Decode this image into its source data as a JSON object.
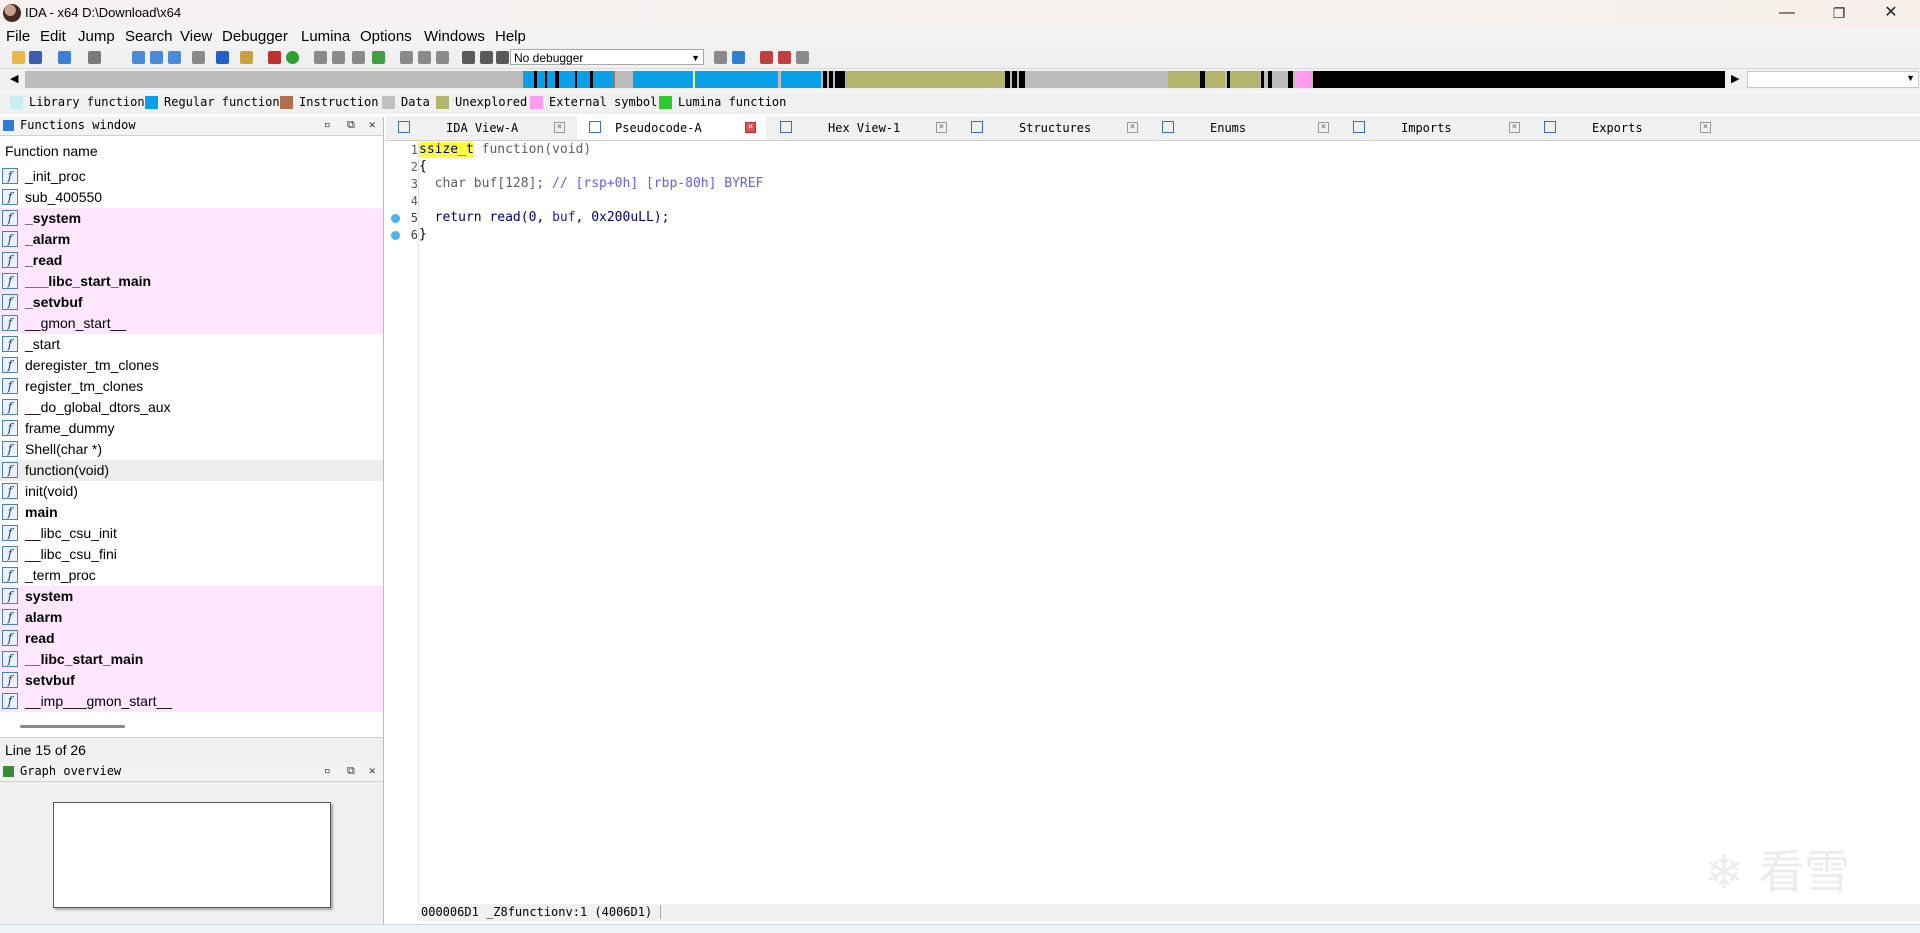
{
  "window": {
    "title": "IDA - x64 D:\\Download\\x64",
    "minimize": "—",
    "maximize": "❐",
    "close": "✕"
  },
  "menu": [
    "File",
    "Edit",
    "Jump",
    "Search",
    "View",
    "Debugger",
    "Lumina",
    "Options",
    "Windows",
    "Help"
  ],
  "toolbar": {
    "debugger_value": "No debugger"
  },
  "legend": [
    {
      "label": "Library function",
      "color": "#c8f0f0"
    },
    {
      "label": "Regular function",
      "color": "#0aa0e8"
    },
    {
      "label": "Instruction",
      "color": "#b07050"
    },
    {
      "label": "Data",
      "color": "#c0c0c0"
    },
    {
      "label": "Unexplored",
      "color": "#b4b46c"
    },
    {
      "label": "External symbol",
      "color": "#ff9cf0"
    },
    {
      "label": "Lumina function",
      "color": "#32c832"
    }
  ],
  "functions_window": {
    "title": "Functions window",
    "column_header": "Function name",
    "status": "Line 15 of 26",
    "items": [
      {
        "name": "_init_proc",
        "style": "normal"
      },
      {
        "name": "sub_400550",
        "style": "normal"
      },
      {
        "name": "_system",
        "style": "ext"
      },
      {
        "name": "_alarm",
        "style": "ext"
      },
      {
        "name": "_read",
        "style": "ext"
      },
      {
        "name": "___libc_start_main",
        "style": "ext"
      },
      {
        "name": "_setvbuf",
        "style": "ext"
      },
      {
        "name": "__gmon_start__",
        "style": "ext-plain"
      },
      {
        "name": "_start",
        "style": "normal"
      },
      {
        "name": "deregister_tm_clones",
        "style": "normal"
      },
      {
        "name": "register_tm_clones",
        "style": "normal"
      },
      {
        "name": "__do_global_dtors_aux",
        "style": "normal"
      },
      {
        "name": "frame_dummy",
        "style": "normal"
      },
      {
        "name": "Shell(char *)",
        "style": "normal"
      },
      {
        "name": "function(void)",
        "style": "selected"
      },
      {
        "name": "init(void)",
        "style": "normal"
      },
      {
        "name": "main",
        "style": "bold"
      },
      {
        "name": "__libc_csu_init",
        "style": "normal"
      },
      {
        "name": "__libc_csu_fini",
        "style": "normal"
      },
      {
        "name": "_term_proc",
        "style": "normal"
      },
      {
        "name": "system",
        "style": "ext"
      },
      {
        "name": "alarm",
        "style": "ext"
      },
      {
        "name": "read",
        "style": "ext"
      },
      {
        "name": "__libc_start_main",
        "style": "ext"
      },
      {
        "name": "setvbuf",
        "style": "ext"
      },
      {
        "name": "__imp___gmon_start__",
        "style": "ext-plain"
      }
    ]
  },
  "graph_overview": {
    "title": "Graph overview"
  },
  "tabs": [
    {
      "label": "IDA View-A",
      "active": false
    },
    {
      "label": "Pseudocode-A",
      "active": true
    },
    {
      "label": "Hex View-1",
      "active": false
    },
    {
      "label": "Structures",
      "active": false
    },
    {
      "label": "Enums",
      "active": false
    },
    {
      "label": "Imports",
      "active": false
    },
    {
      "label": "Exports",
      "active": false
    }
  ],
  "pseudocode": {
    "line_numbers": [
      "1",
      "2",
      "3",
      "4",
      "5",
      "6"
    ],
    "l1_type": "ssize_t",
    "l1_rest": " function(void)",
    "l2": "{",
    "l3_decl": "  char buf[128];",
    "l3_comment": " // [rsp+0h] [rbp-80h] BYREF",
    "l5_ret": "  return read(0, ",
    "l5_buf": "buf",
    "l5_tail": ", 0x200uLL);",
    "l6": "}",
    "status": "000006D1 _Z8functionv:1 (4006D1)"
  },
  "watermark": "❄ 看雪"
}
